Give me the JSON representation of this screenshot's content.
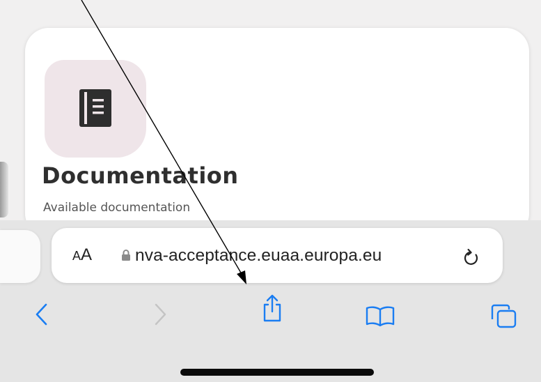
{
  "card": {
    "title": "Documentation",
    "subtitle": "Available documentation",
    "icon": "book-icon",
    "icon_tile_color": "#efe5e9"
  },
  "browser": {
    "text_size_small": "A",
    "text_size_big": "A",
    "url": "nva-acceptance.euaa.europa.eu",
    "lock_icon": "lock-icon",
    "reload_icon": "reload-icon",
    "toolbar": [
      {
        "icon": "back-chevron-icon",
        "enabled": true
      },
      {
        "icon": "forward-chevron-icon",
        "enabled": false
      },
      {
        "icon": "share-icon",
        "enabled": true
      },
      {
        "icon": "bookmarks-icon",
        "enabled": true
      },
      {
        "icon": "tabs-icon",
        "enabled": true
      }
    ],
    "accent_color": "#1a7df2"
  },
  "annotation": {
    "type": "arrow",
    "color": "#000000",
    "points_to": "share-button"
  }
}
